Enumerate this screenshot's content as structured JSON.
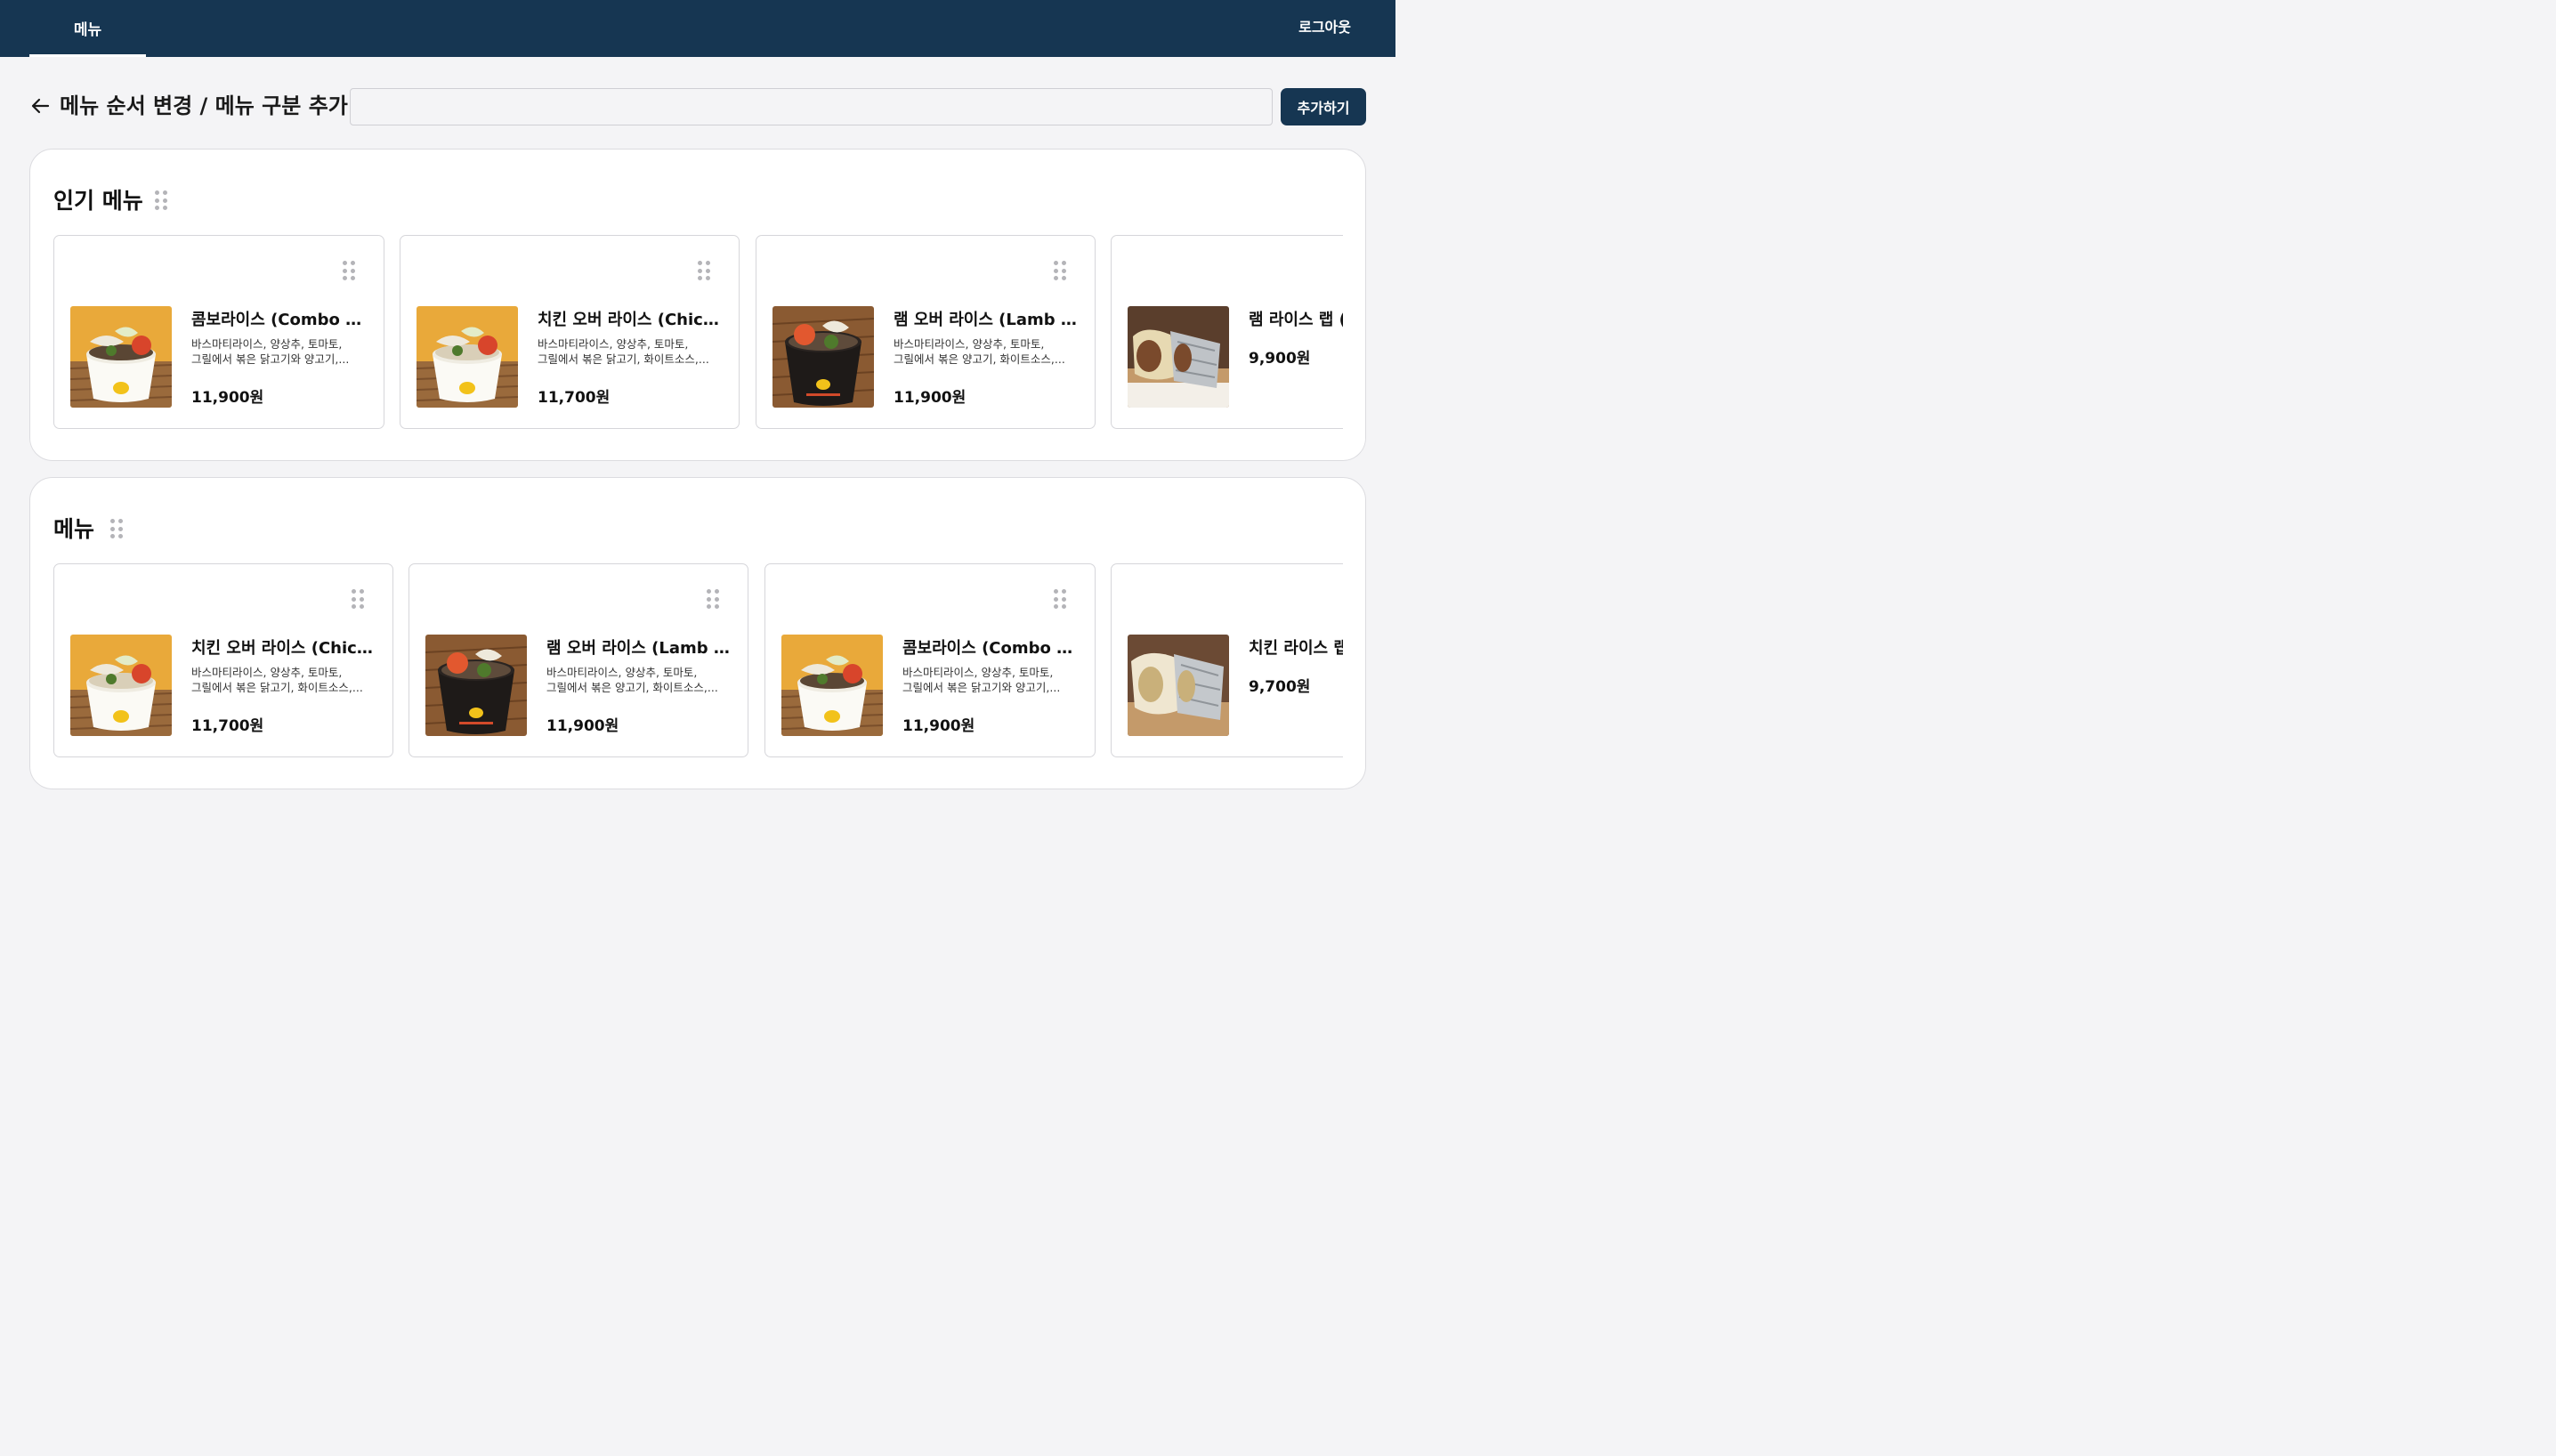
{
  "nav": {
    "tab_menu": "메뉴",
    "logout": "로그아웃"
  },
  "header": {
    "title": "메뉴 순서 변경 / 메뉴 구분 추가",
    "input_value": "",
    "input_placeholder": "",
    "add_button": "추가하기"
  },
  "sections": [
    {
      "title": "인기 메뉴",
      "cards": [
        {
          "name": "콤보라이스 (Combo Rice)",
          "desc1": "바스마티라이스, 양상추, 토마토,",
          "desc2": "그릴에서 볶은 닭고기와 양고기,...",
          "price": "11,900원",
          "image": "rice-bowl-yellow"
        },
        {
          "name": "치킨 오버 라이스 (Chicke...",
          "desc1": "바스마티라이스, 양상추, 토마토,",
          "desc2": "그릴에서 볶은 닭고기, 화이트소스,...",
          "price": "11,700원",
          "image": "rice-bowl-yellow"
        },
        {
          "name": "램 오버 라이스 (Lamb Ov...",
          "desc1": "바스마티라이스, 양상추, 토마토,",
          "desc2": "그릴에서 볶은 양고기, 화이트소스,...",
          "price": "11,900원",
          "image": "rice-bowl-black"
        },
        {
          "name": "램 라이스 랩 (L",
          "price": "9,900원",
          "image": "wrap"
        }
      ]
    },
    {
      "title": "메뉴",
      "cards": [
        {
          "name": "치킨 오버 라이스 (Chicke...",
          "desc1": "바스마티라이스, 양상추, 토마토,",
          "desc2": "그릴에서 볶은 닭고기, 화이트소스,...",
          "price": "11,700원",
          "image": "rice-bowl-yellow"
        },
        {
          "name": "램 오버 라이스 (Lamb Ov...",
          "desc1": "바스마티라이스, 양상추, 토마토,",
          "desc2": "그릴에서 볶은 양고기, 화이트소스,...",
          "price": "11,900원",
          "image": "rice-bowl-black"
        },
        {
          "name": "콤보라이스 (Combo Rice)",
          "desc1": "바스마티라이스, 양상추, 토마토,",
          "desc2": "그릴에서 볶은 닭고기와 양고기,...",
          "price": "11,900원",
          "image": "rice-bowl-yellow"
        },
        {
          "name": "치킨 라이스 랩",
          "price": "9,700원",
          "image": "wrap"
        }
      ]
    }
  ],
  "colors": {
    "navbar": "#163652",
    "button": "#163652",
    "background": "#f4f4f6"
  }
}
